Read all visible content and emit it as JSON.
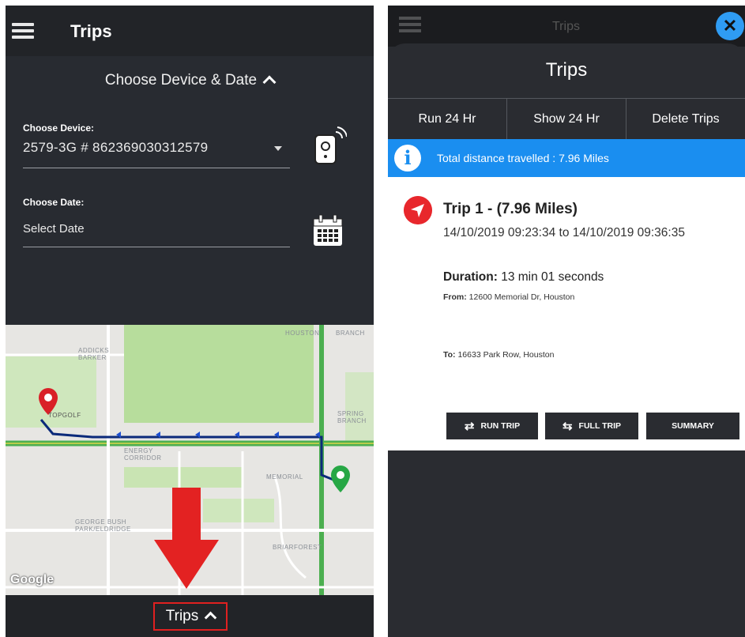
{
  "left": {
    "title": "Trips",
    "chooser_heading": "Choose Device & Date",
    "device_label": "Choose Device:",
    "device_value": "2579-3G # 862369030312579",
    "date_label": "Choose Date:",
    "date_placeholder": "Select Date",
    "map_labels": [
      "HOUSTON",
      "BRANCH",
      "ADDICKS BARKER",
      "ENERGY CORRIDOR",
      "MEMORIAL",
      "GEORGE BUSH PARK/ELDRIDGE",
      "BRIARFOREST",
      "SPRING BRANCH",
      "TOPGOLF"
    ],
    "map_attribution": "Google",
    "bottom_button": "Trips",
    "colors": {
      "start_marker": "#d92027",
      "end_marker": "#27a745",
      "route": "#0b2a7a",
      "arrow": "#e32222"
    }
  },
  "right": {
    "header_title": "Trips",
    "sheet_title": "Trips",
    "tabs": [
      "Run 24 Hr",
      "Show 24 Hr",
      "Delete Trips"
    ],
    "info_text": "Total distance travelled : 7.96 Miles",
    "trip": {
      "title": "Trip 1 - (7.96 Miles)",
      "range": "14/10/2019 09:23:34 to 14/10/2019 09:36:35",
      "duration_label": "Duration:",
      "duration_value": "13 min 01 seconds",
      "from_label": "From:",
      "from_value": "12600 Memorial Dr,  Houston",
      "to_label": "To:",
      "to_value": "16633 Park Row,  Houston"
    },
    "actions": [
      "RUN TRIP",
      "FULL TRIP",
      "SUMMARY"
    ],
    "colors": {
      "info_bar": "#1a8ef0",
      "close_button": "#2f9cf3",
      "nav_icon": "#e8272c"
    }
  }
}
